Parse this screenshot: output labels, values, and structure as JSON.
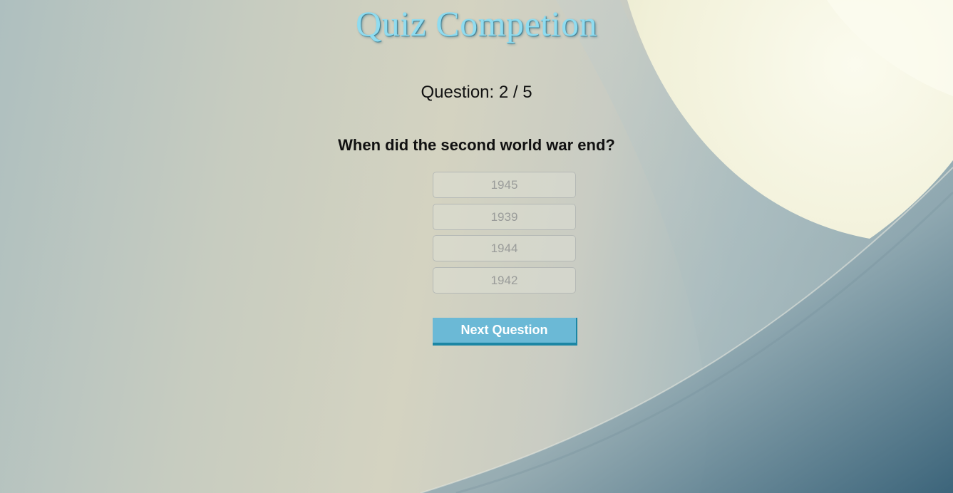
{
  "header": {
    "title": "Quiz Competion"
  },
  "quiz": {
    "counter_label": "Question: 2 / 5",
    "question": "When did the second world war end?",
    "answers": [
      "1945",
      "1939",
      "1944",
      "1942"
    ],
    "next_label": "Next Question"
  },
  "colors": {
    "title": "#8fdcf0",
    "next_button": "#6bb9d6",
    "next_button_border": "#1c86a4"
  }
}
